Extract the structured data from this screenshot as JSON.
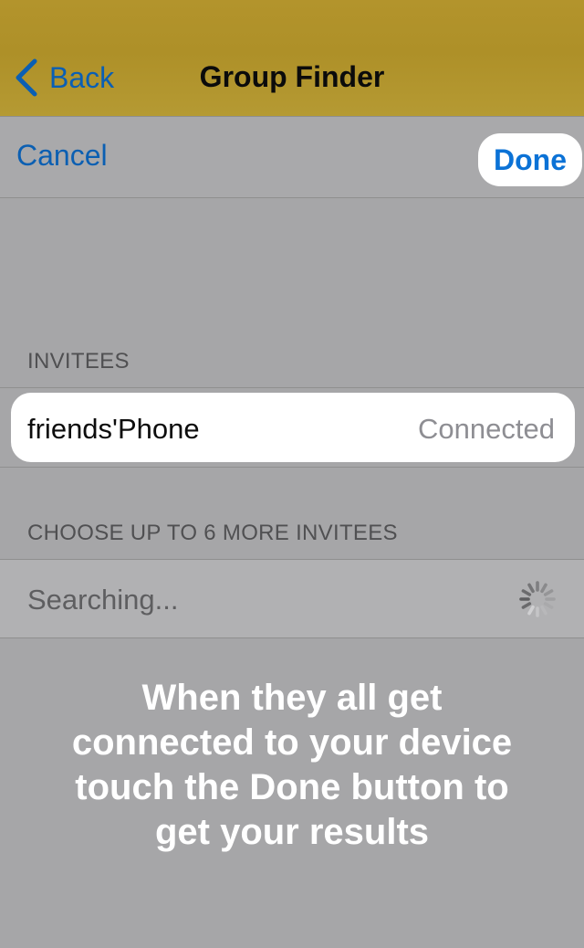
{
  "navbar": {
    "back_label": "Back",
    "title": "Group Finder",
    "back_icon": "chevron-left-icon"
  },
  "toolbar": {
    "cancel_label": "Cancel",
    "done_label": "Done"
  },
  "invitees": {
    "header": "INVITEES",
    "items": [
      {
        "name": "friends'Phone",
        "status": "Connected"
      }
    ]
  },
  "more_invitees": {
    "header": "CHOOSE UP TO 6 MORE INVITEES",
    "searching_label": "Searching...",
    "spinner_icon": "activity-spinner-icon"
  },
  "instructions": {
    "line1": "When they all get",
    "line2": "connected to your device",
    "line3": "touch the Done button to",
    "line4": "get your results"
  },
  "colors": {
    "navbar_gold": "#b3942c",
    "link_blue": "#0a5fb4",
    "done_blue": "#0b72d6",
    "background_gray": "#a6a6a8"
  }
}
